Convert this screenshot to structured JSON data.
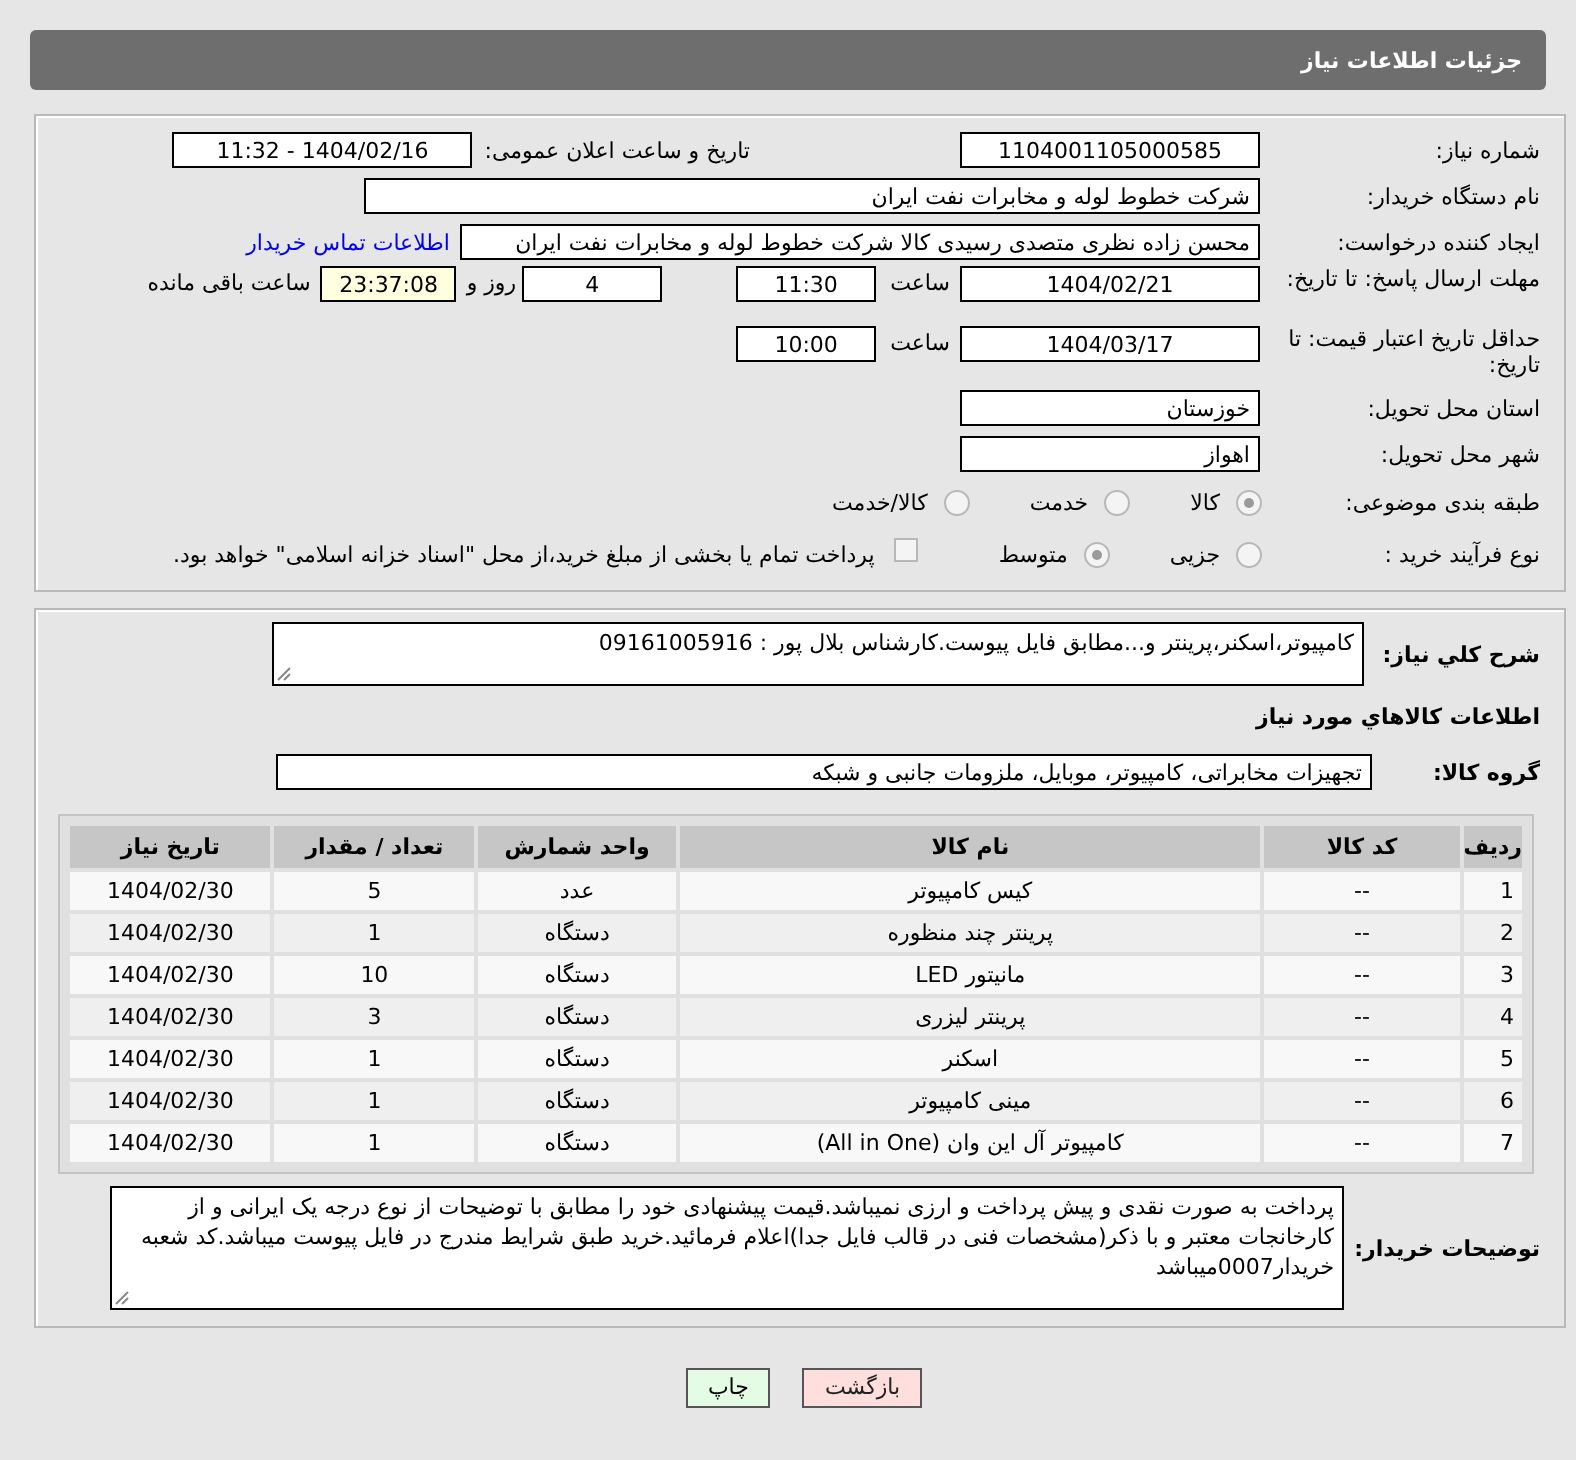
{
  "header": {
    "title": "جزئیات اطلاعات نیاز"
  },
  "need_number": {
    "label": "شماره نیاز:",
    "value": "1104001105000585"
  },
  "announce_datetime": {
    "label": "تاریخ و ساعت اعلان عمومی:",
    "value": "1404/02/16 - 11:32"
  },
  "buyer_org": {
    "label": "نام دستگاه خریدار:",
    "value": "شرکت خطوط لوله و مخابرات نفت ایران"
  },
  "requester": {
    "label": "ایجاد کننده درخواست:",
    "value": "محسن زاده نظری متصدی رسیدی کالا شرکت خطوط لوله و مخابرات نفت ایران",
    "link": "اطلاعات تماس خریدار"
  },
  "response_deadline": {
    "label": "مهلت ارسال پاسخ: تا تاریخ:",
    "date": "1404/02/21",
    "time_label": "ساعت",
    "time": "11:30",
    "days": "4",
    "days_label": "روز و",
    "remaining": "23:37:08",
    "remaining_label": "ساعت باقی مانده"
  },
  "price_validity": {
    "label": "حداقل تاریخ اعتبار قیمت: تا تاریخ:",
    "date": "1404/03/17",
    "time_label": "ساعت",
    "time": "10:00"
  },
  "province": {
    "label": "استان محل تحویل:",
    "value": "خوزستان"
  },
  "city": {
    "label": "شهر محل تحویل:",
    "value": "اهواز"
  },
  "subject_category": {
    "label": "طبقه بندی موضوعی:",
    "options": [
      {
        "label": "کالا",
        "selected": true
      },
      {
        "label": "خدمت",
        "selected": false
      },
      {
        "label": "کالا/خدمت",
        "selected": false
      }
    ]
  },
  "purchase_process": {
    "label": "نوع فرآیند خرید :",
    "options": [
      {
        "label": "جزیی",
        "selected": false
      },
      {
        "label": "متوسط",
        "selected": true
      }
    ],
    "treasury_payment": {
      "label": "پرداخت تمام یا بخشی از مبلغ خرید،از محل \"اسناد خزانه اسلامی\" خواهد بود.",
      "checked": false
    }
  },
  "description": {
    "label": "شرح کلي نياز:",
    "value": "کامپیوتر،اسکنر،پرینتر و...مطابق فایل پیوست.کارشناس بلال پور : 09161005916"
  },
  "goods_section_title": "اطلاعات كالاهاي مورد نياز",
  "goods_group": {
    "label": "گروه کالا:",
    "value": "تجهیزات مخابراتی، کامپیوتر، موبایل، ملزومات جانبی و شبکه"
  },
  "table": {
    "columns": [
      "ردیف",
      "کد کالا",
      "نام کالا",
      "واحد شمارش",
      "تعداد / مقدار",
      "تاریخ نیاز"
    ],
    "rows": [
      [
        "1",
        "--",
        "کیس کامپیوتر",
        "عدد",
        "5",
        "1404/02/30"
      ],
      [
        "2",
        "--",
        "پرینتر چند منظوره",
        "دستگاه",
        "1",
        "1404/02/30"
      ],
      [
        "3",
        "--",
        "مانیتور LED",
        "دستگاه",
        "10",
        "1404/02/30"
      ],
      [
        "4",
        "--",
        "پرینتر لیزری",
        "دستگاه",
        "3",
        "1404/02/30"
      ],
      [
        "5",
        "--",
        "اسکنر",
        "دستگاه",
        "1",
        "1404/02/30"
      ],
      [
        "6",
        "--",
        "مینی کامپیوتر",
        "دستگاه",
        "1",
        "1404/02/30"
      ],
      [
        "7",
        "--",
        "کامپیوتر آل این وان (All in One)",
        "دستگاه",
        "1",
        "1404/02/30"
      ]
    ]
  },
  "buyer_notes": {
    "label": "توضیحات خریدار:",
    "value": "پرداخت به صورت نقدی و پیش پرداخت و ارزی نمیباشد.قیمت پیشنهادی خود را مطابق با توضیحات از نوع درجه یک ایرانی و از کارخانجات معتبر و با ذکر(مشخصات فنی در قالب فایل جدا)اعلام فرمائید.خرید طبق شرایط مندرج در فایل پیوست میباشد.کد شعبه خریدار0007میباشد"
  },
  "buttons": [
    {
      "label": "بازگشت",
      "kind": "back"
    },
    {
      "label": "چاپ",
      "kind": "print"
    }
  ]
}
